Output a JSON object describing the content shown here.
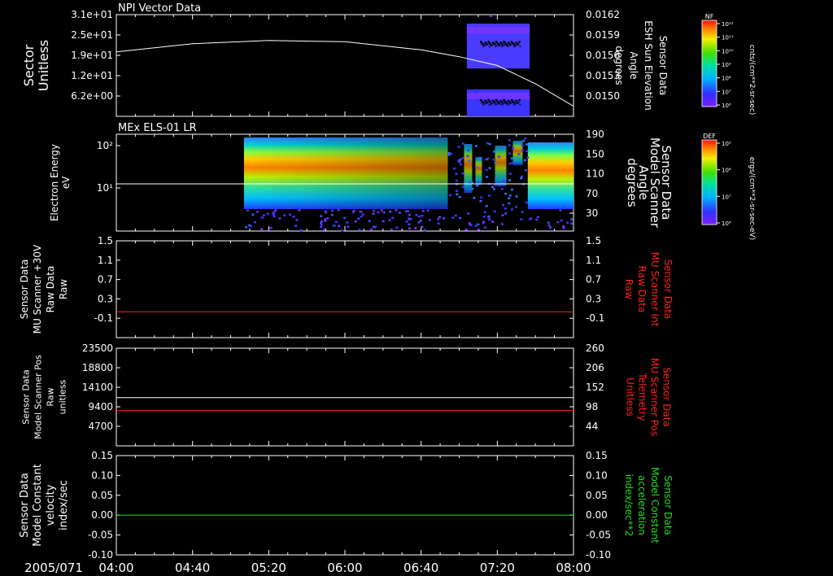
{
  "colors": {
    "background": "#000000",
    "axis": "#ffffff",
    "red": "#ff2020",
    "green": "#22dd22"
  },
  "time_axis": {
    "date": "2005/071",
    "ticks": [
      "04:00",
      "04:40",
      "05:20",
      "06:00",
      "06:40",
      "07:20",
      "08:00"
    ]
  },
  "panels": [
    {
      "id": "npi",
      "title": "NPI Vector Data",
      "left_label": [
        "Sector",
        "Unitless"
      ],
      "left_ticks": [
        "3.1e+01",
        "2.5e+01",
        "1.9e+01",
        "1.2e+01",
        "6.2e+00"
      ],
      "right_label": [
        "Sensor Data",
        "ESH Sun Elevation",
        "Angle",
        "degrees"
      ],
      "right_ticks": [
        "0.0162",
        "0.0159",
        "0.0156",
        "0.0153",
        "0.0150"
      ],
      "colorbar": {
        "title": "NF",
        "tick_labels": [
          "10¹²",
          "10¹¹",
          "10¹⁰",
          "10⁹",
          "10⁸",
          "10⁷",
          "10⁶"
        ],
        "unit": "cnts/(cm**2-sr-sec)"
      }
    },
    {
      "id": "els",
      "title": "MEx ELS-01 LR",
      "left_label": [
        "Electron Energy",
        "eV"
      ],
      "left_ticks": [
        "10²",
        "10¹"
      ],
      "right_label": [
        "Sensor Data",
        "Model Scanner",
        "Angle",
        "degrees"
      ],
      "right_ticks": [
        "190",
        "150",
        "110",
        "70",
        "30"
      ],
      "colorbar": {
        "title": "DEF",
        "tick_labels": [
          "10⁹",
          "10⁸",
          "10⁷",
          "10⁶"
        ],
        "unit": "ergs/(cm**2-sr-sec-eV)"
      }
    },
    {
      "id": "mu30",
      "left_label": [
        "Sensor Data",
        "MU Scanner +30V",
        "Raw Data",
        "Raw"
      ],
      "left_ticks": [
        "1.5",
        "1.1",
        "0.7",
        "0.3",
        "-0.1"
      ],
      "right_label": [
        "Sensor Data",
        "MU Scanner Int",
        "Raw Data",
        "Raw"
      ],
      "right_ticks": [
        "1.5",
        "1.1",
        "0.7",
        "0.3",
        "-0.1"
      ]
    },
    {
      "id": "mupos",
      "left_label": [
        "Sensor Data",
        "Model Scanner Pos",
        "Raw",
        "unitless"
      ],
      "left_ticks": [
        "23500",
        "18800",
        "14100",
        "9400",
        "4700"
      ],
      "right_label": [
        "Sensor Data",
        "MU Scanner Pos",
        "Telemetry",
        "Unitless"
      ],
      "right_ticks": [
        "260",
        "206",
        "152",
        "98",
        "44"
      ]
    },
    {
      "id": "const",
      "left_label": [
        "Sensor Data",
        "Model Constant",
        "velocity",
        "index/sec"
      ],
      "left_ticks": [
        "0.15",
        "0.10",
        "0.05",
        "0.00",
        "-0.05",
        "-0.10"
      ],
      "right_label": [
        "Sensor Data",
        "Model Constant",
        "acceleration",
        "index/sec**2"
      ],
      "right_ticks": [
        "0.15",
        "0.10",
        "0.05",
        "0.00",
        "-0.05",
        "-0.10"
      ]
    }
  ],
  "chart_data": [
    {
      "type": "line",
      "panel": "npi",
      "x": [
        "04:00",
        "04:40",
        "05:20",
        "06:00",
        "06:40",
        "07:00",
        "07:20",
        "07:40",
        "08:00"
      ],
      "series": [
        {
          "values": [
            0.01575,
            0.01587,
            0.01592,
            0.0159,
            0.01578,
            0.01568,
            0.01555,
            0.01528,
            0.01495
          ],
          "color": "#ffffff",
          "axis": "right"
        }
      ],
      "spectrogram_blocks": [
        {
          "x_start": "07:04",
          "x_end": "07:37",
          "y_range": [
            16,
            31
          ]
        },
        {
          "x_start": "07:04",
          "x_end": "07:37",
          "y_range": [
            0,
            9
          ]
        }
      ]
    },
    {
      "type": "heatmap",
      "panel": "els",
      "x_range": [
        "05:07",
        "08:00"
      ],
      "y_scale": "log",
      "gap": [
        "06:54",
        "07:36"
      ],
      "series": [
        {
          "x": [
            "04:00",
            "08:00"
          ],
          "values": [
            90,
            90
          ],
          "color": "#ffffff",
          "axis": "right"
        }
      ]
    },
    {
      "type": "line",
      "panel": "mu30",
      "x": [
        "04:00",
        "08:00"
      ],
      "series": [
        {
          "values": [
            -0.1,
            -0.1
          ],
          "color": "#ff2020"
        }
      ]
    },
    {
      "type": "line",
      "panel": "mupos",
      "x": [
        "04:00",
        "08:00"
      ],
      "series": [
        {
          "values": [
            11600,
            11600
          ],
          "color": "#ffffff"
        },
        {
          "values": [
            8500,
            8500
          ],
          "color": "#ff2020"
        }
      ]
    },
    {
      "type": "line",
      "panel": "const",
      "x": [
        "04:00",
        "08:00"
      ],
      "series": [
        {
          "values": [
            0.0,
            0.0
          ],
          "color": "#22dd22"
        }
      ]
    }
  ]
}
